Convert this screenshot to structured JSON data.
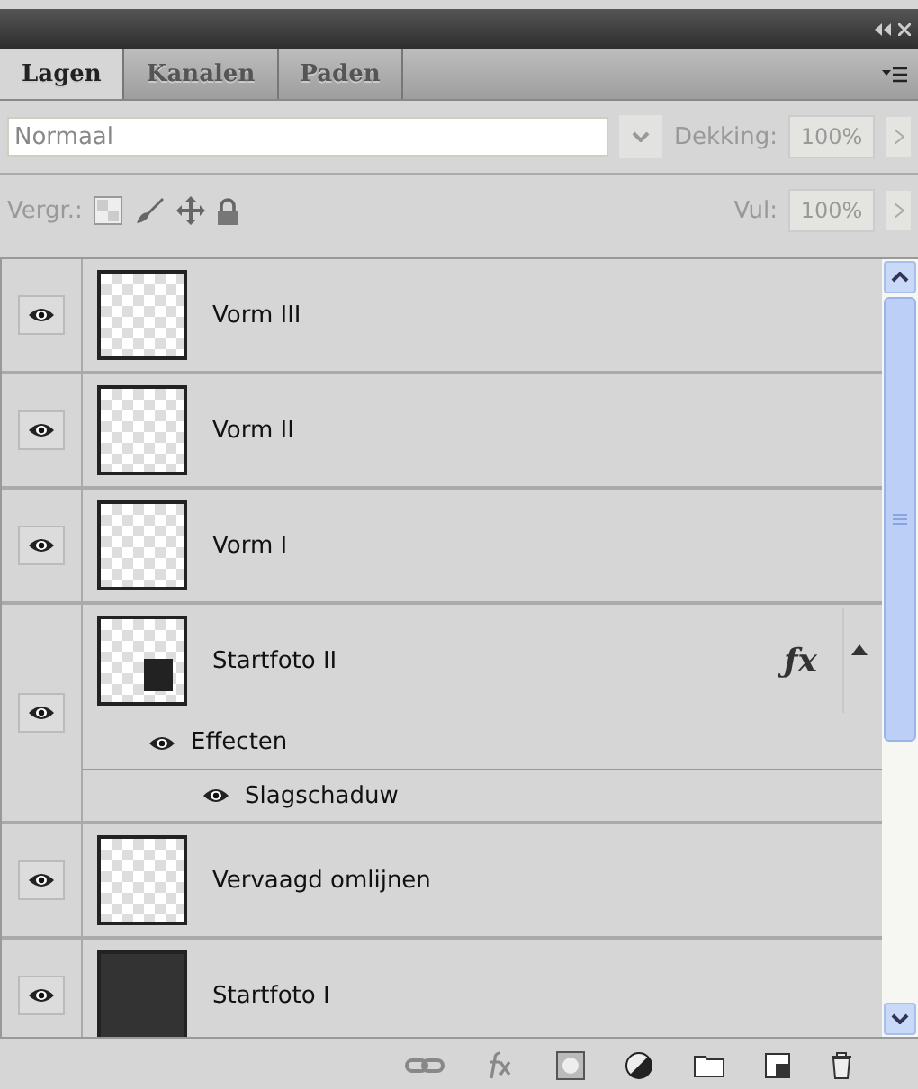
{
  "panel": {
    "tabs": [
      {
        "label": "Lagen",
        "selected": true
      },
      {
        "label": "Kanalen",
        "selected": false
      },
      {
        "label": "Paden",
        "selected": false
      }
    ],
    "blend_mode": {
      "value": "Normaal"
    },
    "opacity": {
      "label": "Dekking:",
      "value": "100%"
    },
    "lock": {
      "label": "Vergr.:"
    },
    "fill": {
      "label": "Vul:",
      "value": "100%"
    }
  },
  "layers": [
    {
      "name": "Vorm III",
      "visible": true,
      "kind": "transparent"
    },
    {
      "name": "Vorm II",
      "visible": true,
      "kind": "transparent"
    },
    {
      "name": "Vorm I",
      "visible": true,
      "kind": "transparent"
    },
    {
      "name": "Startfoto II",
      "visible": true,
      "kind": "small-photo",
      "fx_badge": "ƒx",
      "expanded": true,
      "effects": {
        "label": "Effecten",
        "visible": true,
        "children": [
          {
            "name": "Slagschaduw",
            "visible": true
          }
        ]
      }
    },
    {
      "name": "Vervaagd omlijnen",
      "visible": true,
      "kind": "transparent"
    },
    {
      "name": "Startfoto I",
      "visible": true,
      "kind": "photo"
    }
  ]
}
